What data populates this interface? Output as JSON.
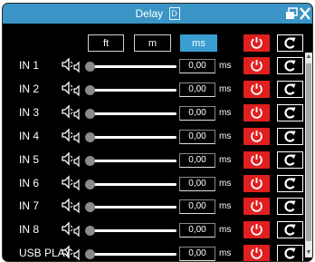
{
  "window": {
    "title": "Delay",
    "title_badge": "D"
  },
  "units": {
    "ft": "ft",
    "m": "m",
    "ms": "ms",
    "selected": "ms"
  },
  "channels": [
    {
      "label": "IN 1",
      "value": "0,00",
      "unit": "ms"
    },
    {
      "label": "IN 2",
      "value": "0,00",
      "unit": "ms"
    },
    {
      "label": "IN 3",
      "value": "0,00",
      "unit": "ms"
    },
    {
      "label": "IN 4",
      "value": "0,00",
      "unit": "ms"
    },
    {
      "label": "IN 5",
      "value": "0,00",
      "unit": "ms"
    },
    {
      "label": "IN 6",
      "value": "0,00",
      "unit": "ms"
    },
    {
      "label": "IN 7",
      "value": "0,00",
      "unit": "ms"
    },
    {
      "label": "IN 8",
      "value": "0,00",
      "unit": "ms"
    },
    {
      "label": "USB PLAY",
      "value": "0,00",
      "unit": "ms"
    }
  ],
  "colors": {
    "titlebar": "#3a95c6",
    "power_active": "#e02020",
    "unit_selected": "#3a9ed0",
    "background": "#000000"
  },
  "icons": {
    "power": "power-icon",
    "reset": "reset-icon",
    "speaker": "speaker-icon",
    "restore": "restore-icon",
    "close": "close-icon"
  }
}
